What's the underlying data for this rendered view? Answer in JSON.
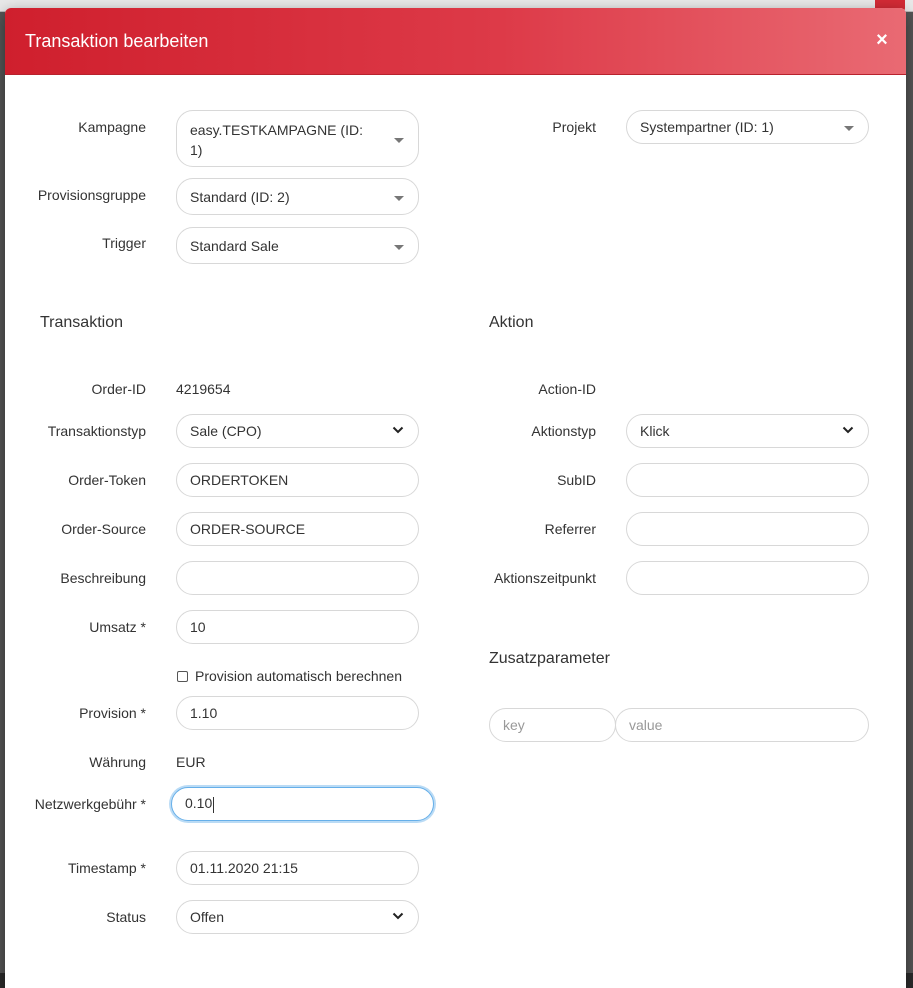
{
  "modal": {
    "title": "Transaktion bearbeiten",
    "close_icon": "×"
  },
  "top": {
    "kampagne": {
      "label": "Kampagne",
      "value": "easy.TESTKAMPAGNE (ID: 1)"
    },
    "projekt": {
      "label": "Projekt",
      "value": "Systempartner (ID: 1)"
    },
    "provisionsgruppe": {
      "label": "Provisionsgruppe",
      "value": "Standard (ID: 2)"
    },
    "trigger": {
      "label": "Trigger",
      "value": "Standard Sale"
    }
  },
  "transaktion": {
    "heading": "Transaktion",
    "order_id": {
      "label": "Order-ID",
      "value": "4219654"
    },
    "transaktionstyp": {
      "label": "Transaktionstyp",
      "value": "Sale (CPO)"
    },
    "order_token": {
      "label": "Order-Token",
      "value": "ORDERTOKEN"
    },
    "order_source": {
      "label": "Order-Source",
      "value": "ORDER-SOURCE"
    },
    "beschreibung": {
      "label": "Beschreibung",
      "value": ""
    },
    "umsatz": {
      "label": "Umsatz *",
      "value": "10"
    },
    "auto_provision": {
      "label": "Provision automatisch berechnen",
      "checked": false
    },
    "provision": {
      "label": "Provision *",
      "value": "1.10"
    },
    "waehrung": {
      "label": "Währung",
      "value": "EUR"
    },
    "netzwerkgebuehr": {
      "label": "Netzwerkgebühr *",
      "value": "0.10"
    },
    "timestamp": {
      "label": "Timestamp *",
      "value": "01.11.2020 21:15"
    },
    "status": {
      "label": "Status",
      "value": "Offen"
    }
  },
  "aktion": {
    "heading": "Aktion",
    "action_id": {
      "label": "Action-ID",
      "value": ""
    },
    "aktionstyp": {
      "label": "Aktionstyp",
      "value": "Klick"
    },
    "subid": {
      "label": "SubID",
      "value": ""
    },
    "referrer": {
      "label": "Referrer",
      "value": ""
    },
    "aktionszeitpunkt": {
      "label": "Aktionszeitpunkt",
      "value": ""
    }
  },
  "zusatz": {
    "heading": "Zusatzparameter",
    "key_placeholder": "key",
    "value_placeholder": "value"
  },
  "colors": {
    "header_start": "#cf1f2d",
    "header_end": "#e96a73",
    "focus": "#66afe9"
  }
}
